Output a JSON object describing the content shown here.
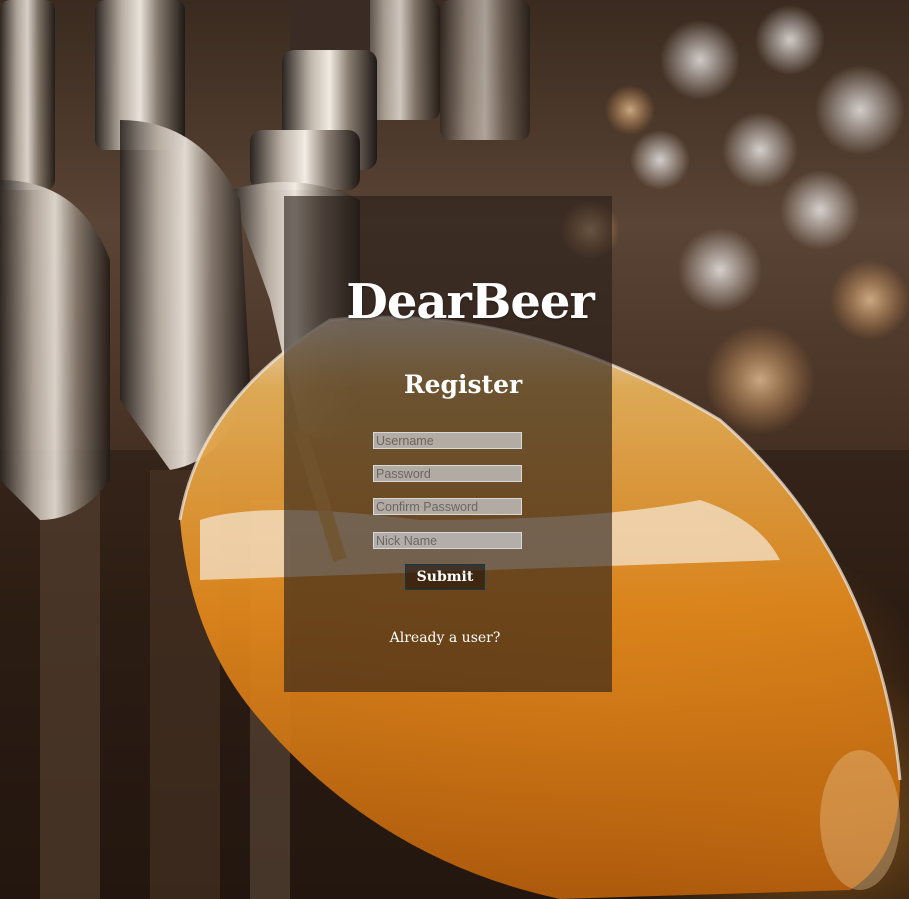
{
  "app": {
    "brand": "DearBeer"
  },
  "form": {
    "heading": "Register",
    "username_placeholder": "Username",
    "password_placeholder": "Password",
    "confirm_password_placeholder": "Confirm Password",
    "nickname_placeholder": "Nick Name",
    "submit_label": "Submit",
    "login_link": "Already a user?"
  },
  "colors": {
    "panel_overlay": "#281e1a",
    "text": "#ffffff",
    "submit_border": "#0e3b4a",
    "input_fill": "#bebcba"
  },
  "background": {
    "image_description_icon": "beer-tap-photo"
  }
}
